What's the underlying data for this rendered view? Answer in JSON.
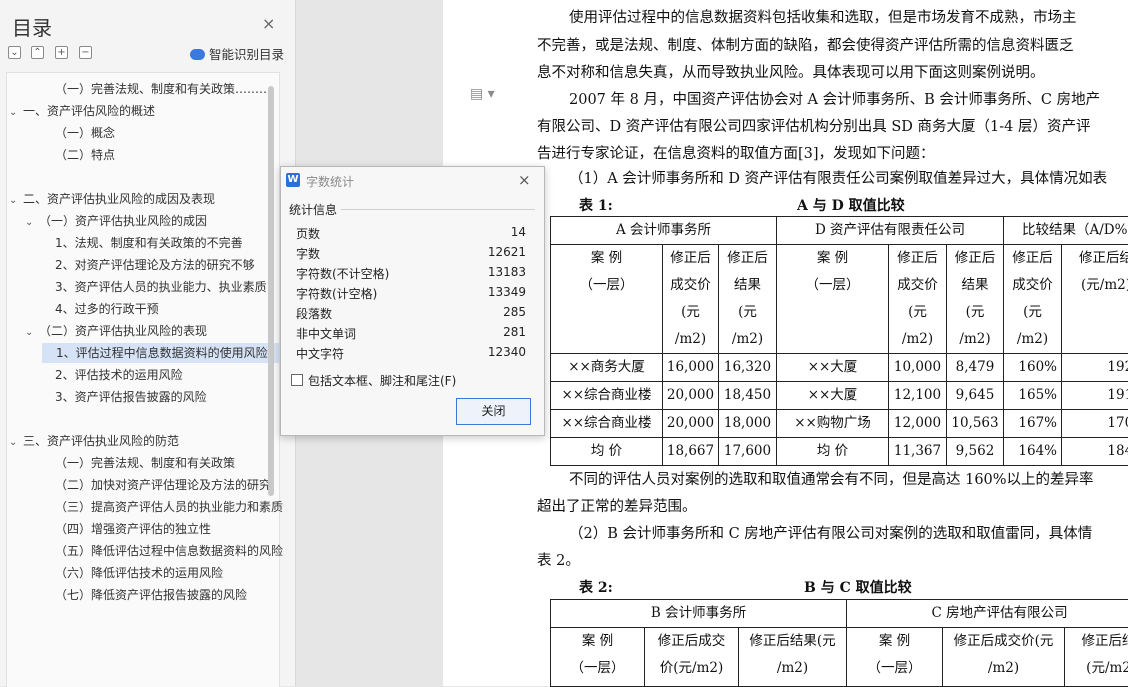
{
  "toc": {
    "title": "目录",
    "close_icon": "×",
    "tool_icons": [
      "⌄",
      "⌃",
      "+",
      "−"
    ],
    "smart_label": "智能识别目录",
    "items": [
      {
        "label": "（一）完善法规、制度和有关政策………",
        "level": 2,
        "selected": false
      },
      {
        "label": "一、资产评估风险的概述",
        "level": 0,
        "selected": false
      },
      {
        "label": "（一）概念",
        "level": 2,
        "selected": false
      },
      {
        "label": "（二）特点",
        "level": 2,
        "selected": false
      },
      {
        "label": "二、资产评估执业风险的成因及表现",
        "level": 0,
        "selected": false
      },
      {
        "label": "（一）资产评估执业风险的成因",
        "level": 1,
        "selected": false
      },
      {
        "label": "1、法规、制度和有关政策的不完善",
        "level": 2,
        "selected": false
      },
      {
        "label": "2、对资产评估理论及方法的研究不够",
        "level": 2,
        "selected": false
      },
      {
        "label": "3、资产评估人员的执业能力、执业素质",
        "level": 2,
        "selected": false
      },
      {
        "label": "4、过多的行政干预",
        "level": 2,
        "selected": false
      },
      {
        "label": "（二）资产评估执业风险的表现",
        "level": 1,
        "selected": false
      },
      {
        "label": "1、评估过程中信息数据资料的使用风险",
        "level": 2,
        "selected": true
      },
      {
        "label": "2、评估技术的运用风险",
        "level": 2,
        "selected": false
      },
      {
        "label": "3、资产评估报告披露的风险",
        "level": 2,
        "selected": false
      },
      {
        "label": "三、资产评估执业风险的防范",
        "level": 0,
        "selected": false
      },
      {
        "label": "（一）完善法规、制度和有关政策",
        "level": 2,
        "selected": false
      },
      {
        "label": "（二）加快对资产评估理论及方法的研究",
        "level": 2,
        "selected": false
      },
      {
        "label": "（三）提高资产评估人员的执业能力和素质",
        "level": 2,
        "selected": false
      },
      {
        "label": "（四）增强资产评估的独立性",
        "level": 2,
        "selected": false
      },
      {
        "label": "（五）降低评估过程中信息数据资料的风险",
        "level": 2,
        "selected": false
      },
      {
        "label": "（六）降低评估技术的运用风险",
        "level": 2,
        "selected": false
      },
      {
        "label": "（七）降低资产评估报告披露的风险",
        "level": 2,
        "selected": false
      }
    ]
  },
  "dialog": {
    "title": "字数统计",
    "close_icon": "×",
    "group_label": "统计信息",
    "stats": [
      {
        "label": "页数",
        "value": "14"
      },
      {
        "label": "字数",
        "value": "12621"
      },
      {
        "label": "字符数(不计空格)",
        "value": "13183"
      },
      {
        "label": "字符数(计空格)",
        "value": "13349"
      },
      {
        "label": "段落数",
        "value": "285"
      },
      {
        "label": "非中文单词",
        "value": "281"
      },
      {
        "label": "中文字符",
        "value": "12340"
      }
    ],
    "include_label": "包括文本框、脚注和尾注(F)",
    "close_button": "关闭"
  },
  "document": {
    "page_icon": "▤ ▾",
    "lines": [
      "使用评估过程中的信息数据资料包括收集和选取，但是市场发育不成熟，市场主",
      "不完善，或是法规、制度、体制方面的缺陷，都会使得资产评估所需的信息资料匮乏",
      "息不对称和信息失真，从而导致执业风险。具体表现可以用下面这则案例说明。",
      "2007 年 8 月，中国资产评估协会对 A 会计师事务所、B 会计师事务所、C 房地产",
      "有限公司、D 资产评估有限公司四家评估机构分别出具 SD 商务大厦（1-4 层）资产评",
      "告进行专家论证，在信息资料的取值方面[3]，发现如下问题：",
      "（1）A 会计师事务所和 D 资产评估有限责任公司案例取值差异过大，具体情况如表"
    ],
    "table1": {
      "label": "表 1:",
      "title": "A 与 D 取值比较",
      "groups": [
        "A 会计师事务所",
        "D 资产评估有限责任公司",
        "比较结果（A/D%"
      ],
      "sub_headers": [
        "案 例\n（一层）",
        "修正后\n成交价\n(元\n/m2)",
        "修正后\n结果\n(元\n/m2)",
        "案 例\n（一层）",
        "修正后\n成交价\n(元\n/m2)",
        "修正后\n结果\n(元\n/m2)",
        "修正后\n成交价\n(元\n/m2)",
        "修正后结\n(元/m2)"
      ],
      "rows": [
        [
          "××商务大厦",
          "16,000",
          "16,320",
          "××大厦",
          "10,000",
          "8,479",
          "160%",
          "192%"
        ],
        [
          "××综合商业楼",
          "20,000",
          "18,450",
          "××大厦",
          "12,100",
          "9,645",
          "165%",
          "191%"
        ],
        [
          "××综合商业楼",
          "20,000",
          "18,000",
          "××购物广场",
          "12,000",
          "10,563",
          "167%",
          "170%"
        ],
        [
          "均 价",
          "18,667",
          "17,600",
          "均 价",
          "11,367",
          "9,562",
          "164%",
          "184%"
        ]
      ]
    },
    "after_lines": [
      "不同的评估人员对案例的选取和取值通常会有不同，但是高达 160%以上的差异率",
      "超出了正常的差异范围。",
      "（2）B 会计师事务所和 C 房地产评估有限公司对案例的选取和取值雷同，具体情",
      "表 2。"
    ],
    "table2": {
      "label": "表 2:",
      "title": "B 与 C 取值比较",
      "groups": [
        "B 会计师事务所",
        "C 房地产评估有限公司"
      ],
      "sub_headers": [
        "案 例\n（一层）",
        "修正后成交\n价(元/m2)",
        "修正后结果(元\n/m2)",
        "案 例\n（一层）",
        "修正后成交价(元\n/m2)",
        "修正后结\n(元/m2"
      ]
    }
  }
}
